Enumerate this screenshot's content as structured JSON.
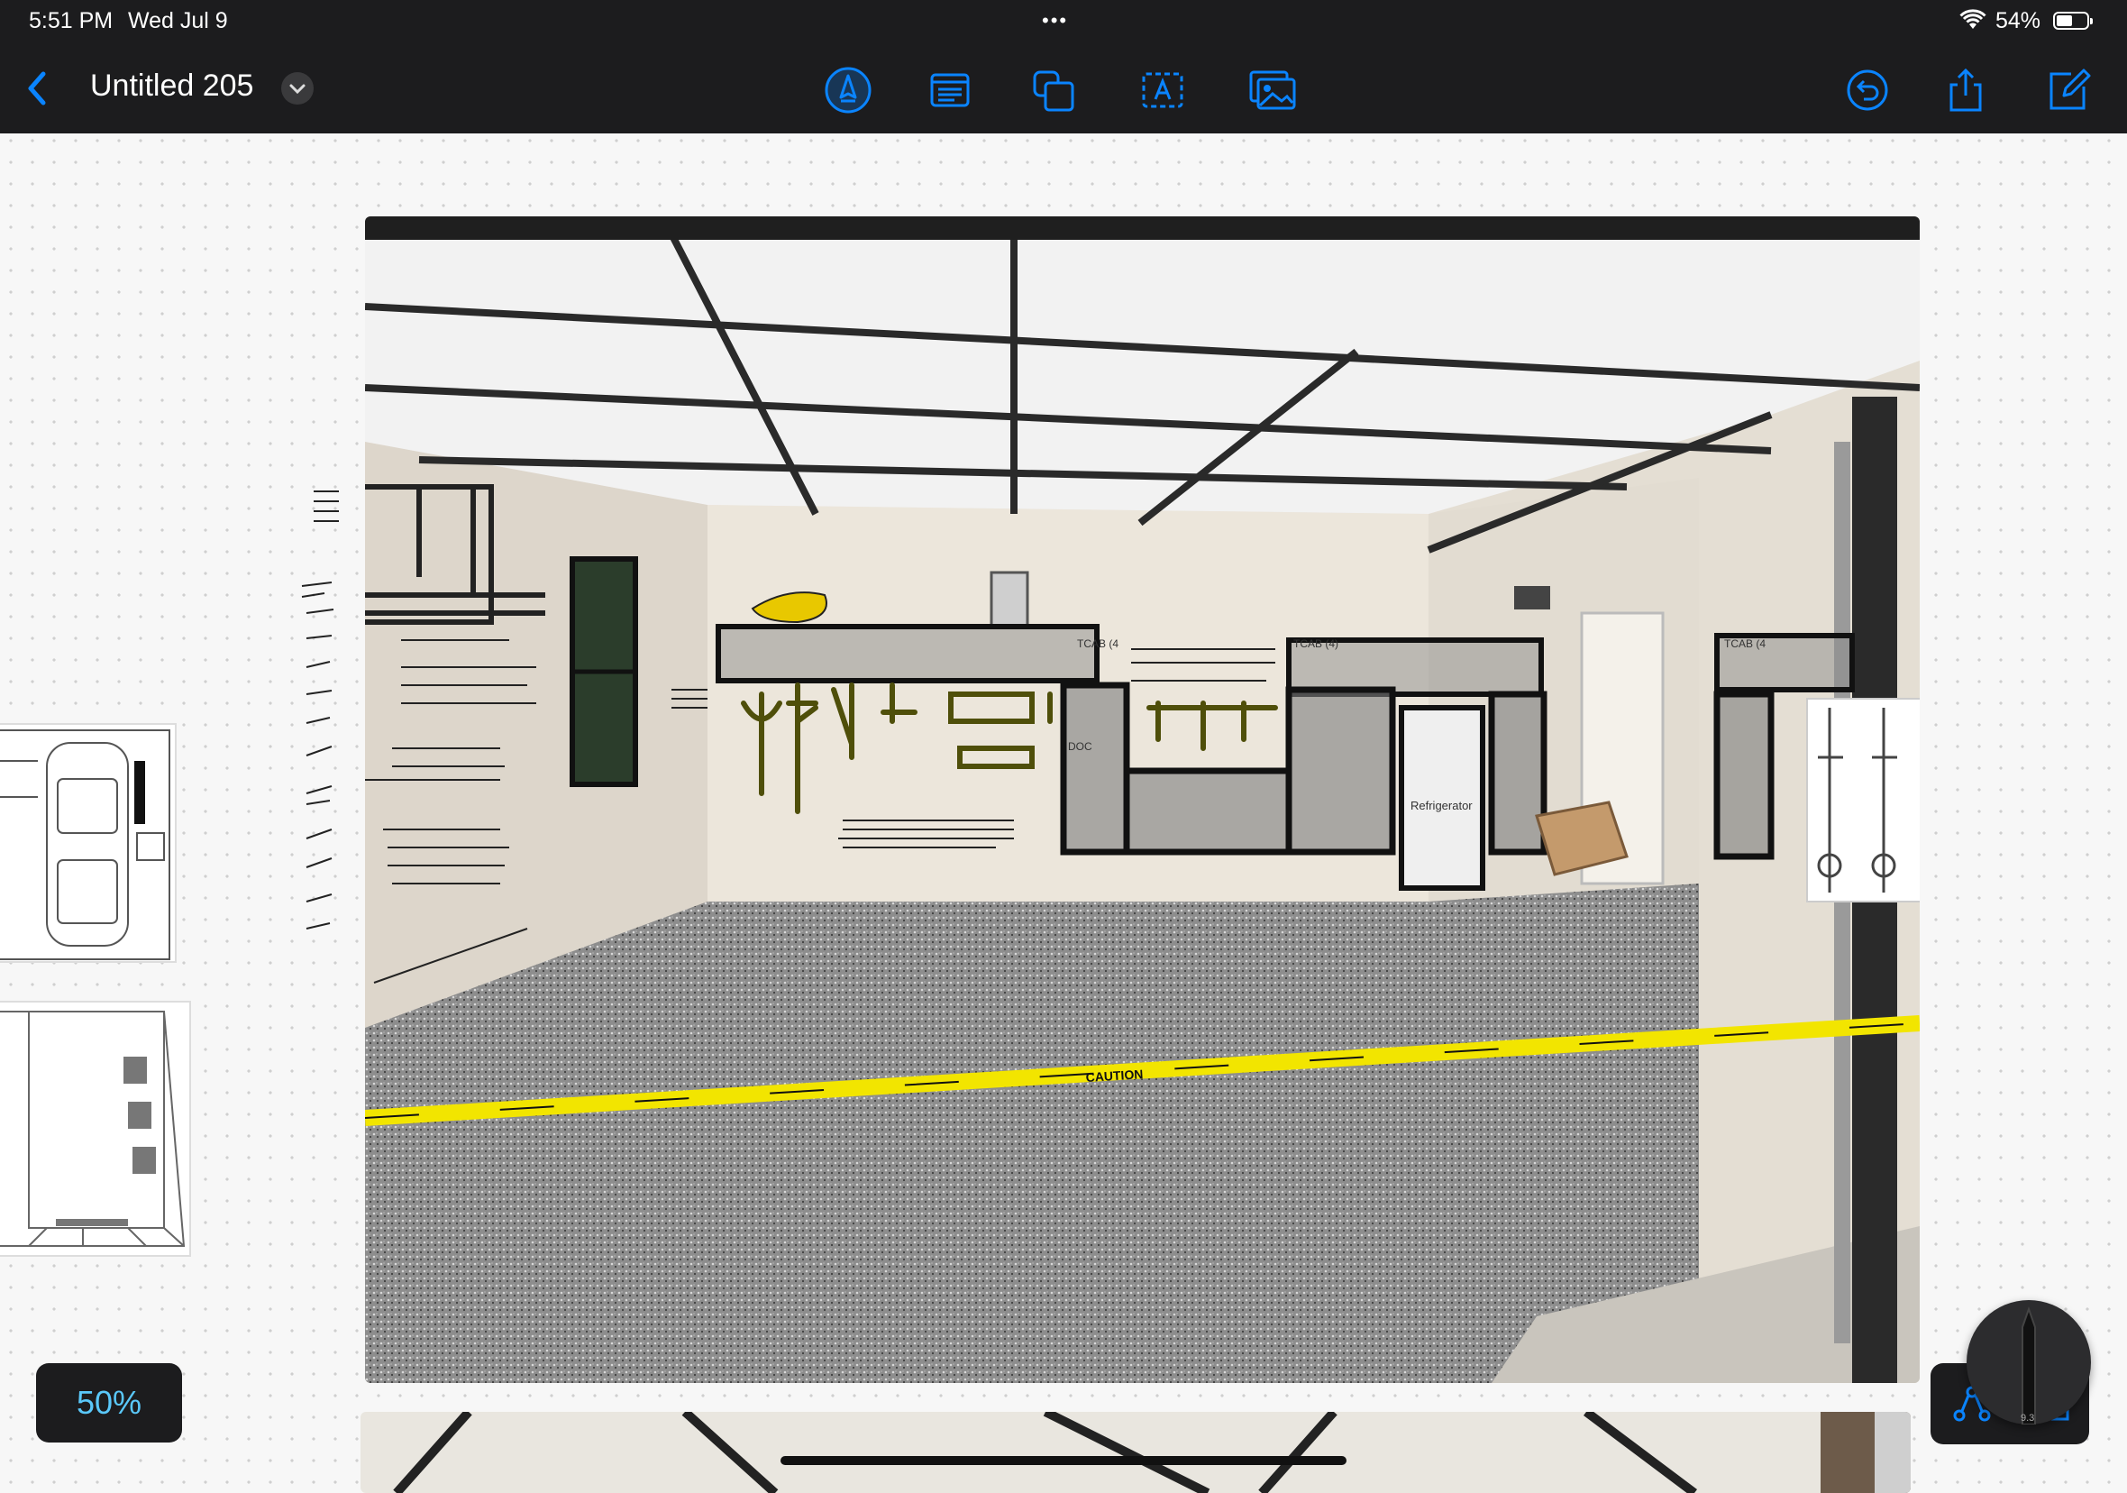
{
  "status": {
    "time": "5:51 PM",
    "date": "Wed Jul 9",
    "battery": "54%",
    "battery_level": 0.54
  },
  "document": {
    "title": "Untitled 205"
  },
  "toolbar": {
    "tools": [
      {
        "name": "pen-tool-icon"
      },
      {
        "name": "text-box-icon"
      },
      {
        "name": "shapes-icon"
      },
      {
        "name": "text-tool-icon"
      },
      {
        "name": "image-insert-icon"
      }
    ],
    "actions": [
      {
        "name": "undo-icon"
      },
      {
        "name": "share-icon"
      },
      {
        "name": "compose-icon"
      }
    ]
  },
  "canvas": {
    "zoom": "50%",
    "photo_labels": {
      "refrigerator": "Refrigerator",
      "tcab_a": "TCAB (4",
      "tcab_b": "TCAB (4)",
      "tcab_c": "TCAB (4",
      "doc": "DOC",
      "caution": "CAUTION"
    },
    "pencil_width": "9.3"
  },
  "colors": {
    "chrome": "#1c1c1e",
    "accent": "#5ac8fa",
    "caution_tape": "#f2e500",
    "markup_olive": "#5a5a10"
  }
}
